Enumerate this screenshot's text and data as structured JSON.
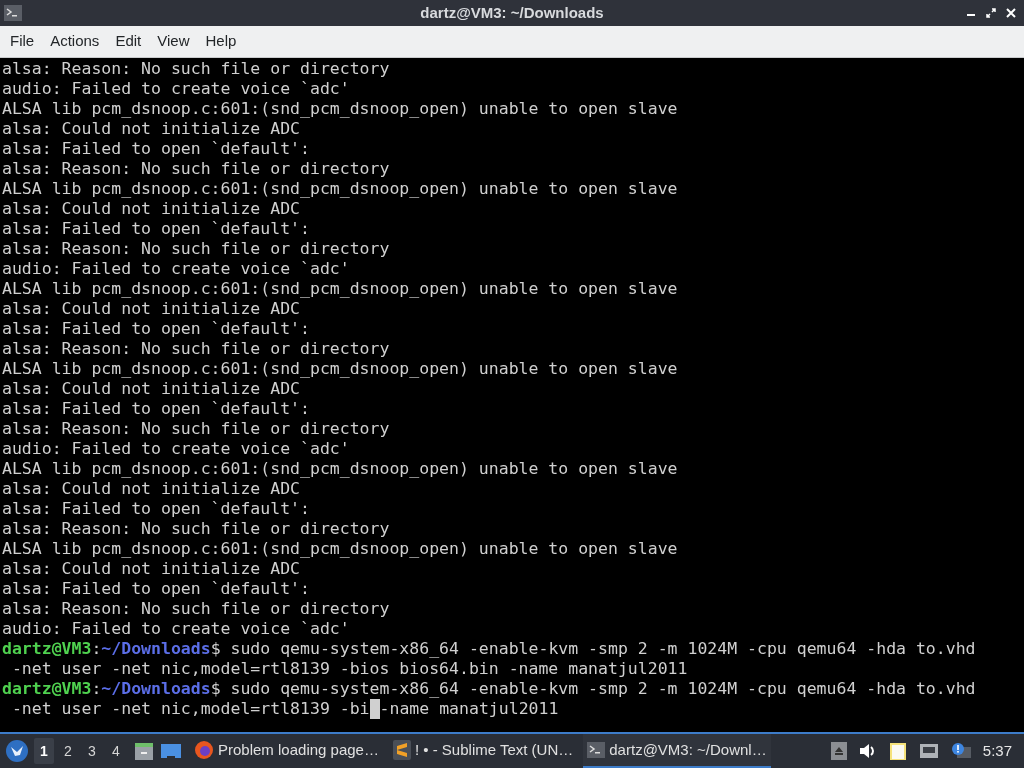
{
  "window": {
    "title": "dartz@VM3: ~/Downloads"
  },
  "menu": [
    "File",
    "Actions",
    "Edit",
    "View",
    "Help"
  ],
  "terminal": {
    "lines": [
      {
        "kind": "output",
        "text": "alsa: Reason: No such file or directory"
      },
      {
        "kind": "output",
        "text": "audio: Failed to create voice `adc'"
      },
      {
        "kind": "output",
        "text": "ALSA lib pcm_dsnoop.c:601:(snd_pcm_dsnoop_open) unable to open slave"
      },
      {
        "kind": "output",
        "text": "alsa: Could not initialize ADC"
      },
      {
        "kind": "output",
        "text": "alsa: Failed to open `default':"
      },
      {
        "kind": "output",
        "text": "alsa: Reason: No such file or directory"
      },
      {
        "kind": "output",
        "text": "ALSA lib pcm_dsnoop.c:601:(snd_pcm_dsnoop_open) unable to open slave"
      },
      {
        "kind": "output",
        "text": "alsa: Could not initialize ADC"
      },
      {
        "kind": "output",
        "text": "alsa: Failed to open `default':"
      },
      {
        "kind": "output",
        "text": "alsa: Reason: No such file or directory"
      },
      {
        "kind": "output",
        "text": "audio: Failed to create voice `adc'"
      },
      {
        "kind": "output",
        "text": "ALSA lib pcm_dsnoop.c:601:(snd_pcm_dsnoop_open) unable to open slave"
      },
      {
        "kind": "output",
        "text": "alsa: Could not initialize ADC"
      },
      {
        "kind": "output",
        "text": "alsa: Failed to open `default':"
      },
      {
        "kind": "output",
        "text": "alsa: Reason: No such file or directory"
      },
      {
        "kind": "output",
        "text": "ALSA lib pcm_dsnoop.c:601:(snd_pcm_dsnoop_open) unable to open slave"
      },
      {
        "kind": "output",
        "text": "alsa: Could not initialize ADC"
      },
      {
        "kind": "output",
        "text": "alsa: Failed to open `default':"
      },
      {
        "kind": "output",
        "text": "alsa: Reason: No such file or directory"
      },
      {
        "kind": "output",
        "text": "audio: Failed to create voice `adc'"
      },
      {
        "kind": "output",
        "text": "ALSA lib pcm_dsnoop.c:601:(snd_pcm_dsnoop_open) unable to open slave"
      },
      {
        "kind": "output",
        "text": "alsa: Could not initialize ADC"
      },
      {
        "kind": "output",
        "text": "alsa: Failed to open `default':"
      },
      {
        "kind": "output",
        "text": "alsa: Reason: No such file or directory"
      },
      {
        "kind": "output",
        "text": "ALSA lib pcm_dsnoop.c:601:(snd_pcm_dsnoop_open) unable to open slave"
      },
      {
        "kind": "output",
        "text": "alsa: Could not initialize ADC"
      },
      {
        "kind": "output",
        "text": "alsa: Failed to open `default':"
      },
      {
        "kind": "output",
        "text": "alsa: Reason: No such file or directory"
      },
      {
        "kind": "output",
        "text": "audio: Failed to create voice `adc'"
      },
      {
        "kind": "prompt",
        "user": "dartz@VM3",
        "sep": ":",
        "path": "~/Downloads",
        "command": "$ sudo qemu-system-x86_64 -enable-kvm -smp 2 -m 1024M -cpu qemu64 -hda to.vhd"
      },
      {
        "kind": "output",
        "text": " -net user -net nic,model=rtl8139 -bios bios64.bin -name manatjul2011"
      },
      {
        "kind": "prompt",
        "user": "dartz@VM3",
        "sep": ":",
        "path": "~/Downloads",
        "command": "$ sudo qemu-system-x86_64 -enable-kvm -smp 2 -m 1024M -cpu qemu64 -hda to.vhd"
      },
      {
        "kind": "cursor_line",
        "before": " -net user -net nic,model=rtl8139 -bi",
        "after": "-name manatjul2011"
      }
    ]
  },
  "taskbar": {
    "workspaces": [
      {
        "label": "1",
        "selected": true
      },
      {
        "label": "2",
        "selected": false
      },
      {
        "label": "3",
        "selected": false
      },
      {
        "label": "4",
        "selected": false
      }
    ],
    "tasks": [
      {
        "kind": "browser",
        "label": "Problem loading page…",
        "selected": false
      },
      {
        "kind": "editor",
        "label": "! • - Sublime Text (UN…",
        "selected": false
      },
      {
        "kind": "terminal",
        "label": "dartz@VM3: ~/Downl…",
        "selected": true
      }
    ],
    "clock": "5:37"
  }
}
